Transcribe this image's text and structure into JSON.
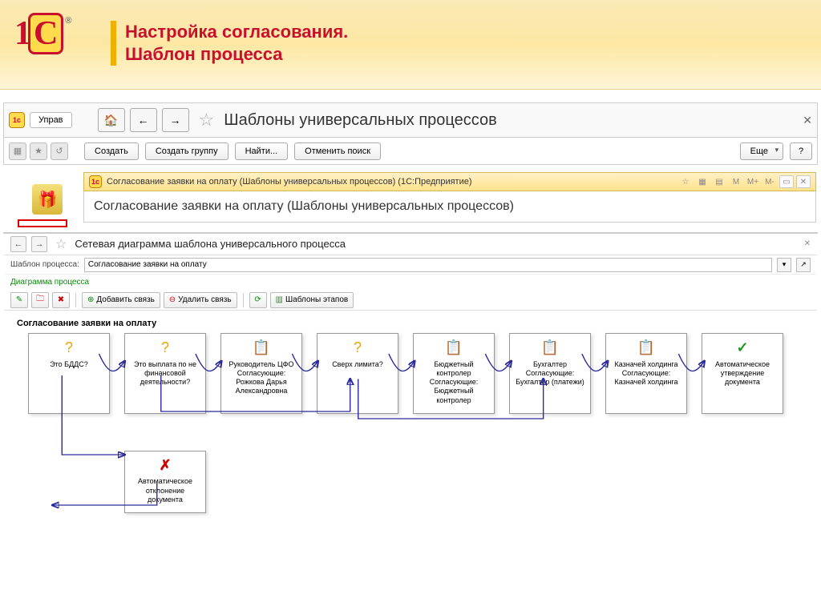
{
  "slide": {
    "title_line1": "Настройка согласования.",
    "title_line2": "Шаблон процесса"
  },
  "topnav": {
    "tab": "Управ",
    "title": "Шаблоны универсальных процессов",
    "create": "Создать",
    "create_group": "Создать группу",
    "find": "Найти...",
    "cancel_find": "Отменить поиск",
    "more": "Еще",
    "help": "?"
  },
  "modal": {
    "titlebar": "Согласование заявки на оплату (Шаблоны универсальных процессов)  (1С:Предприятие)",
    "m": "M",
    "mplus": "M+",
    "mminus": "M-",
    "heading": "Согласование заявки на оплату (Шаблоны универсальных процессов)"
  },
  "diagram_win": {
    "title": "Сетевая диаграмма шаблона универсального процесса",
    "field_label": "Шаблон процесса:",
    "field_value": "Согласование заявки на оплату",
    "section": "Диаграмма процесса",
    "toolbar": {
      "add_link": "Добавить связь",
      "del_link": "Удалить связь",
      "stage_tpl": "Шаблоны этапов"
    },
    "canvas_title": "Согласование заявки на оплату"
  },
  "nodes": {
    "n1": "Это БДДС?",
    "n2": "Это выплата по не финансовой деятельности?",
    "n3": "Руководитель ЦФО\nСогласующие:\nРожкова Дарья Александровна",
    "n4": "Сверх лимита?",
    "n5": "Бюджетный контролер\nСогласующие:\nБюджетный контролер",
    "n6": "Бухгалтер\nСогласующие:\nБухгалтер (платежи)",
    "n7": "Казначей холдинга\nСогласующие:\nКазначей холдинга",
    "n8": "Автоматическое утверждение документа",
    "n9": "Автоматическое отклонение документа"
  }
}
